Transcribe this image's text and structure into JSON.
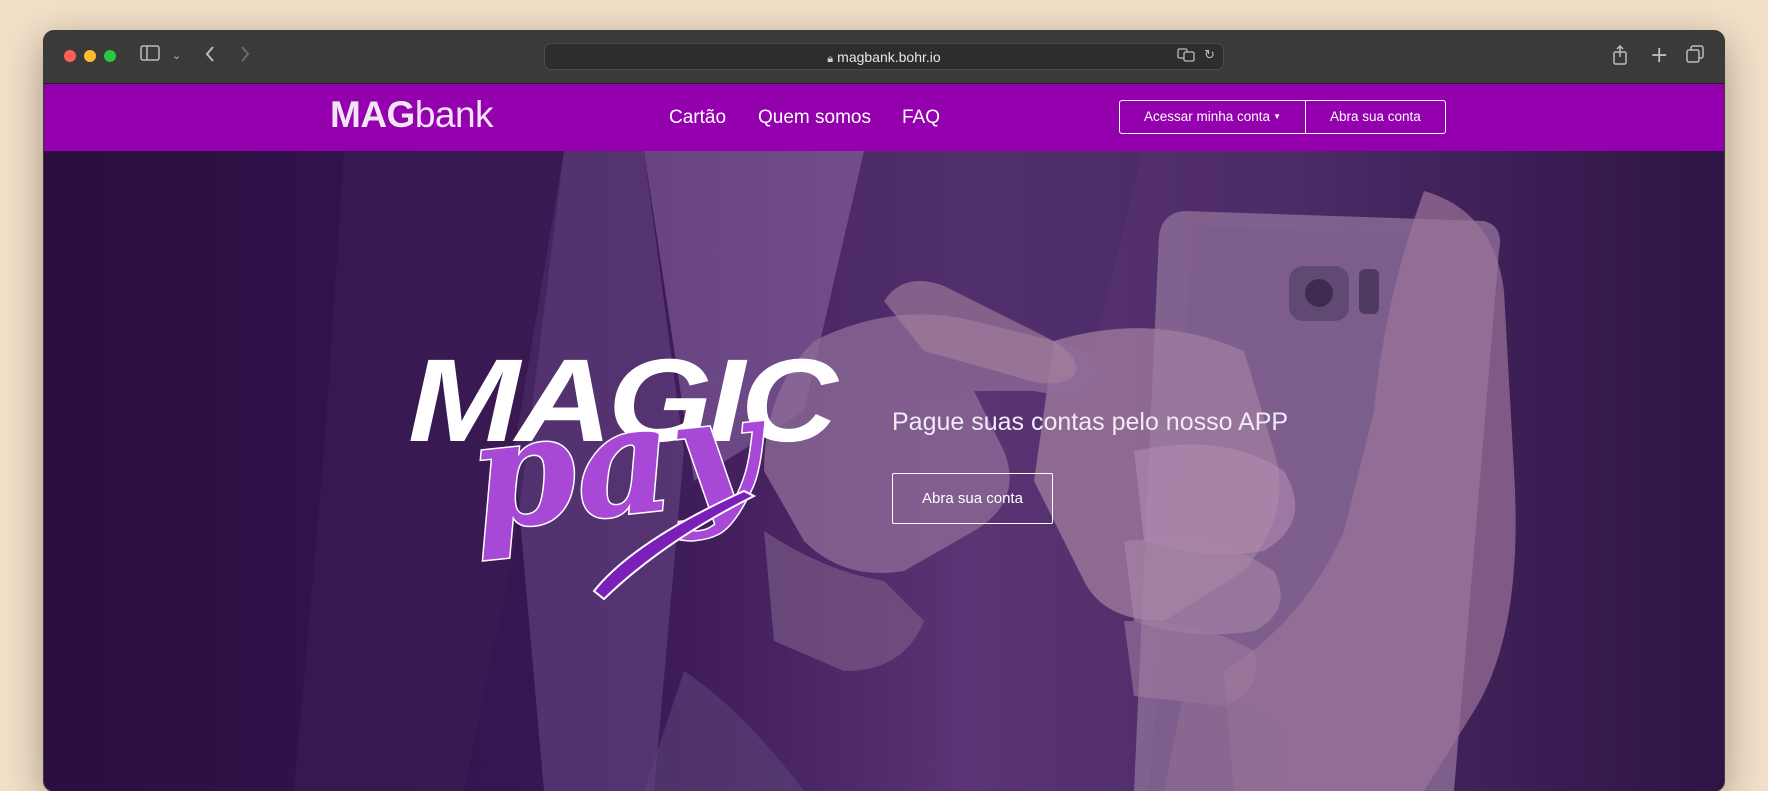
{
  "browser": {
    "url": "magbank.bohr.io",
    "icons": [
      "sidebar-icon",
      "chevron-down-icon",
      "back-icon",
      "forward-icon",
      "lock-icon",
      "translate-icon",
      "reload-icon",
      "share-icon",
      "new-tab-icon",
      "tabs-overview-icon"
    ]
  },
  "header": {
    "logo_bold": "MAG",
    "logo_light": "bank",
    "nav": [
      {
        "label": "Cartão"
      },
      {
        "label": "Quem somos"
      },
      {
        "label": "FAQ"
      }
    ],
    "login_label": "Acessar minha conta",
    "signup_label": "Abra sua conta"
  },
  "hero": {
    "logo_title": "MAGIC",
    "logo_script": "pay",
    "tagline": "Pague suas contas pelo nosso APP",
    "cta_label": "Abra sua conta"
  },
  "colors": {
    "brand_purple": "#9400ad",
    "hero_overlay": "#3a1755",
    "script_purple": "#a040d0"
  }
}
